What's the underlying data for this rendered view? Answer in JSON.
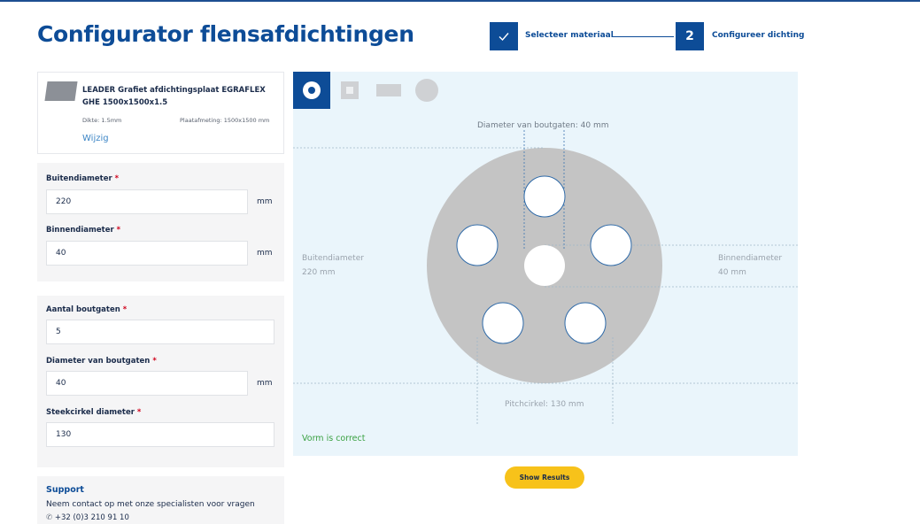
{
  "header": {
    "title": "Configurator flensafdichtingen"
  },
  "stepper": {
    "step1": {
      "label": "Selecteer materiaal",
      "state": "done"
    },
    "step2": {
      "number": "2",
      "label": "Configureer dichting",
      "state": "active"
    }
  },
  "material": {
    "title": "LEADER Grafiet afdichtingsplaat EGRAFLEX GHE 1500x1500x1.5",
    "thickness": "Dikte: 1.5mm",
    "plate": "Plaatafmeting: 1500x1500 mm",
    "change_link": "Wijzig"
  },
  "form": {
    "outer": {
      "label": "Buitendiameter",
      "value": "220",
      "unit": "mm"
    },
    "inner": {
      "label": "Binnendiameter",
      "value": "40",
      "unit": "mm"
    },
    "bolt_count": {
      "label": "Aantal boutgaten",
      "value": "5"
    },
    "bolt_diameter": {
      "label": "Diameter van boutgaten",
      "value": "40",
      "unit": "mm"
    },
    "pitch": {
      "label": "Steekcirkel diameter",
      "value": "130"
    },
    "required_mark": "*"
  },
  "canvas": {
    "shapes": [
      "ring-icon",
      "square-icon",
      "rectangle-icon",
      "circle-icon"
    ],
    "active_shape": "ring-icon",
    "dim_bolt": "Diameter van boutgaten: 40 mm",
    "dim_outer_label": "Buitendiameter",
    "dim_outer_value": "220 mm",
    "dim_inner_label": "Binnendiameter",
    "dim_inner_value": "40 mm",
    "dim_pitch": "Pitchcirkel: 130 mm",
    "status": "Vorm is correct"
  },
  "actions": {
    "show_results": "Show Results"
  },
  "support": {
    "title": "Support",
    "text": "Neem contact op met onze specialisten voor vragen",
    "phone": "+32 (0)3 210 91 10"
  },
  "colors": {
    "brand": "#0d4c97",
    "accent": "#f7c21a",
    "gasket": "#c4c4c4",
    "canvas_bg": "#eaf5fb",
    "ok": "#3aa142"
  }
}
